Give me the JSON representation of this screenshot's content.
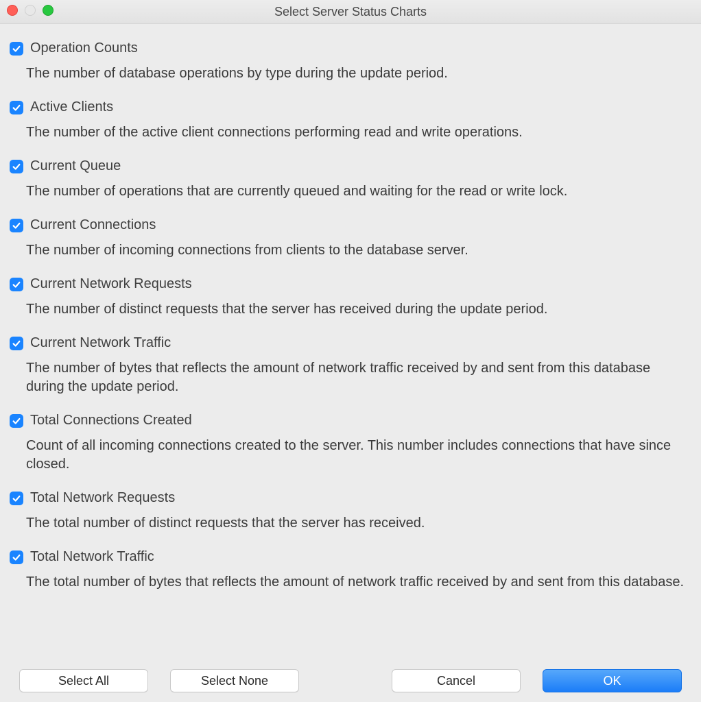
{
  "window": {
    "title": "Select Server Status Charts"
  },
  "options": [
    {
      "label": "Operation Counts",
      "description": "The number of database operations by type during the update period.",
      "checked": true
    },
    {
      "label": "Active Clients",
      "description": "The number of the active client connections performing read and write operations.",
      "checked": true
    },
    {
      "label": "Current Queue",
      "description": "The number of operations that are currently queued and waiting for the read or write lock.",
      "checked": true
    },
    {
      "label": "Current Connections",
      "description": "The number of incoming connections from clients to the database server.",
      "checked": true
    },
    {
      "label": "Current Network Requests",
      "description": "The number of distinct requests that the server has received during the update period.",
      "checked": true
    },
    {
      "label": "Current Network Traffic",
      "description": "The number of bytes that reflects the amount of network traffic received by and sent from this database during the update period.",
      "checked": true
    },
    {
      "label": "Total Connections Created",
      "description": "Count of all incoming connections created to the server. This number includes connections that have since closed.",
      "checked": true
    },
    {
      "label": "Total Network Requests",
      "description": "The total number of distinct requests that the server has received.",
      "checked": true
    },
    {
      "label": "Total Network Traffic",
      "description": "The total number of bytes that reflects the amount of network traffic received by and sent from this database.",
      "checked": true
    }
  ],
  "buttons": {
    "select_all": "Select All",
    "select_none": "Select None",
    "cancel": "Cancel",
    "ok": "OK"
  }
}
